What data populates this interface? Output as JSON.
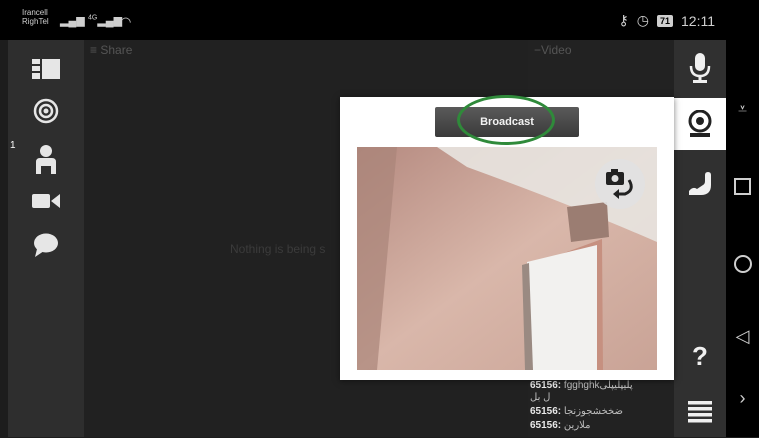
{
  "status_bar": {
    "carrier1": "Irancell",
    "carrier2": "RighTel",
    "signal_text": "4G",
    "battery": "71",
    "time": "12:11"
  },
  "share_panel": {
    "title": "Share",
    "empty_message": "Nothing is being s"
  },
  "video_panel": {
    "title": "Video"
  },
  "left_toolbar": {
    "badge_count": "1"
  },
  "dialog": {
    "broadcast_label": "Broadcast"
  },
  "chat": {
    "lines": [
      {
        "user": "65156:",
        "text": "fgghghkپلیپلیپلی"
      },
      {
        "user": "",
        "text": "ل بل"
      },
      {
        "user": "65156:",
        "text": "ضخخشجوزنجا"
      },
      {
        "user": "65156:",
        "text": "ملارین"
      }
    ]
  },
  "colors": {
    "accent_ring": "#2f8a3a",
    "toolbar_bg": "#303030",
    "dialog_bg": "#ffffff"
  }
}
